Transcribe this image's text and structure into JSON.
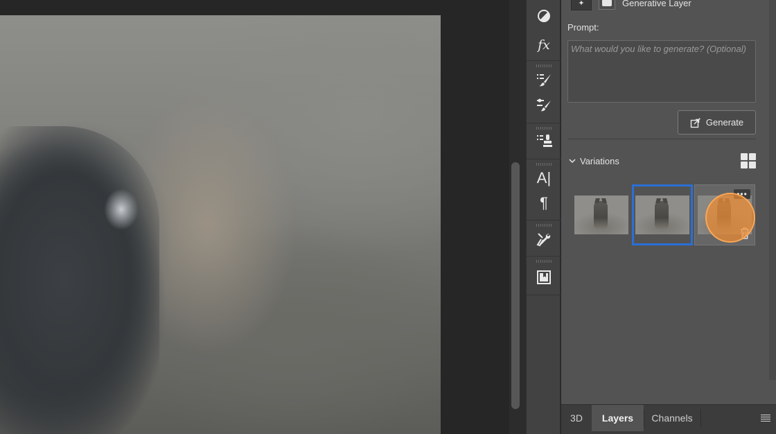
{
  "layer_header": {
    "title": "Generative Layer"
  },
  "properties": {
    "prompt_label": "Prompt:",
    "prompt_placeholder": "What would you like to generate? (Optional)",
    "prompt_value": "",
    "generate_label": "Generate",
    "variations_label": "Variations",
    "selected_variation": 2
  },
  "tools": [
    "adjustments-icon",
    "fx-styles-icon",
    "brush-presets-icon",
    "brush-settings-icon",
    "clone-source-icon",
    "character-icon",
    "paragraph-icon",
    "tool-presets-icon",
    "glyphs-icon"
  ],
  "bottom_tabs": [
    {
      "label": "3D",
      "active": false
    },
    {
      "label": "Layers",
      "active": true
    },
    {
      "label": "Channels",
      "active": false
    }
  ],
  "colors": {
    "selection_border": "#2a6fd6",
    "cursor_highlight": "#ee8c32",
    "panel_bg": "#535353"
  }
}
